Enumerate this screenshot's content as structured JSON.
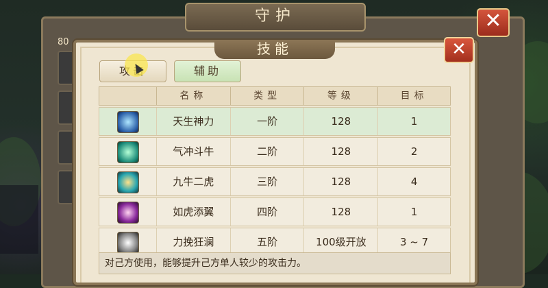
{
  "back_window": {
    "title": "守护",
    "close_label": "✕",
    "level_badge": "80"
  },
  "panel": {
    "title": "技能",
    "close_label": "✕"
  },
  "tabs": [
    {
      "label": "攻击"
    },
    {
      "label": "辅助"
    }
  ],
  "table": {
    "headers": [
      "",
      "名称",
      "类型",
      "等级",
      "目标"
    ],
    "rows": [
      {
        "icon": "skill-tiansheng-icon",
        "name": "天生神力",
        "type": "一阶",
        "level": "128",
        "target": "1"
      },
      {
        "icon": "skill-qichong-icon",
        "name": "气冲斗牛",
        "type": "二阶",
        "level": "128",
        "target": "2"
      },
      {
        "icon": "skill-jiuniu-icon",
        "name": "九牛二虎",
        "type": "三阶",
        "level": "128",
        "target": "4"
      },
      {
        "icon": "skill-ruhu-icon",
        "name": "如虎添翼",
        "type": "四阶",
        "level": "128",
        "target": "1"
      },
      {
        "icon": "skill-liwan-icon",
        "name": "力挽狂澜",
        "type": "五阶",
        "level": "100级开放",
        "target": "3 ~ 7"
      }
    ]
  },
  "description": "对己方使用，能够提升己方单人较少的攻击力。",
  "colors": {
    "accent_red": "#c8432c",
    "selected_row": "#dcebd4",
    "panel_bg": "#efe6d2"
  }
}
